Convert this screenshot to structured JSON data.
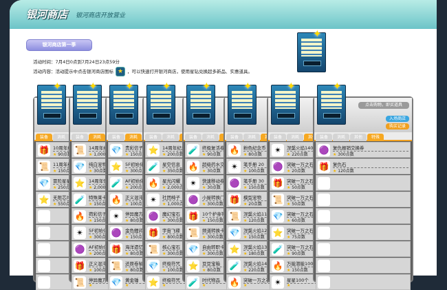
{
  "header": {
    "title": "银河商店",
    "subtitle": "银河商店开放营业"
  },
  "season_button": "银河商店第一季",
  "info": {
    "time": "活动时间：7月4日0点到7月24日23点59分",
    "content_before": "活动内容：活动提示中点击银河商店图标",
    "content_after": "，可以快速打开银河商店，使用星钻兑换超多新品、实惠道具。"
  },
  "icons": {
    "shop": "star-icon",
    "price": "star-icon"
  },
  "colors": {
    "header": "#6cc4c8",
    "active_tab": "#f6a822",
    "frame": "#5c5c5c"
  },
  "tabs": [
    "装备",
    "消耗",
    "其他",
    "特殊"
  ],
  "last_panel": {
    "notice": "点击购物，即买道具",
    "enter": "入场商店",
    "record": "购买记录"
  },
  "panels": [
    {
      "active": 0,
      "items": [
        [
          "10周年纪念",
          "90点数"
        ],
        [
          "11周年纪念",
          "150点数"
        ],
        [
          "冒险星星",
          "250点数"
        ],
        [
          "无限芯片",
          "550点数"
        ],
        null,
        null,
        null,
        null,
        null
      ]
    },
    {
      "active": 1,
      "items": [
        [
          "14周年纪念",
          "1,000点数"
        ],
        [
          "纯白宠物",
          "30点数"
        ],
        [
          "14周年情侣",
          "2,000点数"
        ],
        [
          "特殊莱卡",
          "150点数"
        ],
        [
          "荷彩信子卡",
          "150点数"
        ],
        [
          "5F初始化",
          "300点数"
        ],
        [
          "AF初始化",
          "200点数"
        ],
        [
          "正义混沌",
          "100点数"
        ],
        [
          "停异魔方",
          ""
        ]
      ]
    },
    {
      "active": 1,
      "items": [
        [
          "贵彩信子卡",
          "150点数"
        ],
        [
          "5F初始化",
          "300点数"
        ],
        [
          "AF初始化",
          "200点数"
        ],
        [
          "正义混沌",
          "100点数"
        ],
        [
          "停异魔方",
          "80点数"
        ],
        [
          "金色鲤卯",
          "150点数"
        ],
        [
          "海洋遗忆",
          "80点数"
        ],
        [
          "还原卷轴",
          "80点数"
        ],
        [
          "黄金锤",
          ""
        ]
      ]
    },
    {
      "active": 2,
      "items": [
        [
          "14周年纪念",
          "200点数"
        ],
        [
          "星空信息",
          "350点数"
        ],
        [
          "星光闪耀",
          "2,000点数"
        ],
        [
          "社团椅子",
          "1,000点数"
        ],
        [
          "魔幻宝石",
          "300点数"
        ],
        [
          "宇宙飞碟",
          "800点数"
        ],
        [
          "核心宝石",
          "300点数"
        ],
        [
          "终极符咒",
          "100点数"
        ],
        [
          "终极符咒",
          ""
        ]
      ]
    },
    {
      "active": 2,
      "items": [
        [
          "终极复活卷",
          "90点数"
        ],
        [
          "超级药水交换",
          "30点数"
        ],
        [
          "快速移动卷",
          "30点数"
        ],
        [
          "小屋转换门",
          "300点数"
        ],
        [
          "10个护身符",
          "150点数"
        ],
        [
          "频道转换卡",
          "300点数"
        ],
        [
          "自由转职卡",
          "300点数"
        ],
        [
          "豆豆宝箱",
          "80点数"
        ],
        [
          "时代物品",
          ""
        ]
      ]
    },
    {
      "active": 2,
      "items": [
        [
          "粉色纪念币",
          "80点数"
        ],
        [
          "笔手册 20",
          "100点数"
        ],
        [
          "笔手册 30",
          "150点数"
        ],
        [
          "模型宠物",
          "20点数"
        ],
        [
          "涅槃火焰110",
          "120点数"
        ],
        [
          "涅槃火焰120",
          "150点数"
        ],
        [
          "涅槃火焰130",
          "180点数"
        ],
        [
          "涅槃火焰140",
          "220点数"
        ],
        [
          "突破一万之石",
          ""
        ]
      ]
    },
    {
      "active": 2,
      "items": [
        [
          "涅槃火焰140",
          "220点数"
        ],
        [
          "突破一万之石",
          "20点数"
        ],
        [
          "突破一万之石",
          "50点数"
        ],
        [
          "突破一万之石",
          "50点数"
        ],
        [
          "突破一万之石",
          "60点数"
        ],
        [
          "突破一万之石",
          "75点数"
        ],
        [
          "突破一万之石",
          "90点数"
        ],
        [
          "万能潜能100",
          "150点数"
        ],
        [
          "星星100个",
          ""
        ]
      ]
    },
    {
      "active": 3,
      "items": [
        [
          "复仇报销交换券",
          "300点数"
        ],
        [
          "复仇石",
          "120点数"
        ],
        null,
        null,
        null,
        null,
        null,
        null,
        null
      ]
    }
  ]
}
